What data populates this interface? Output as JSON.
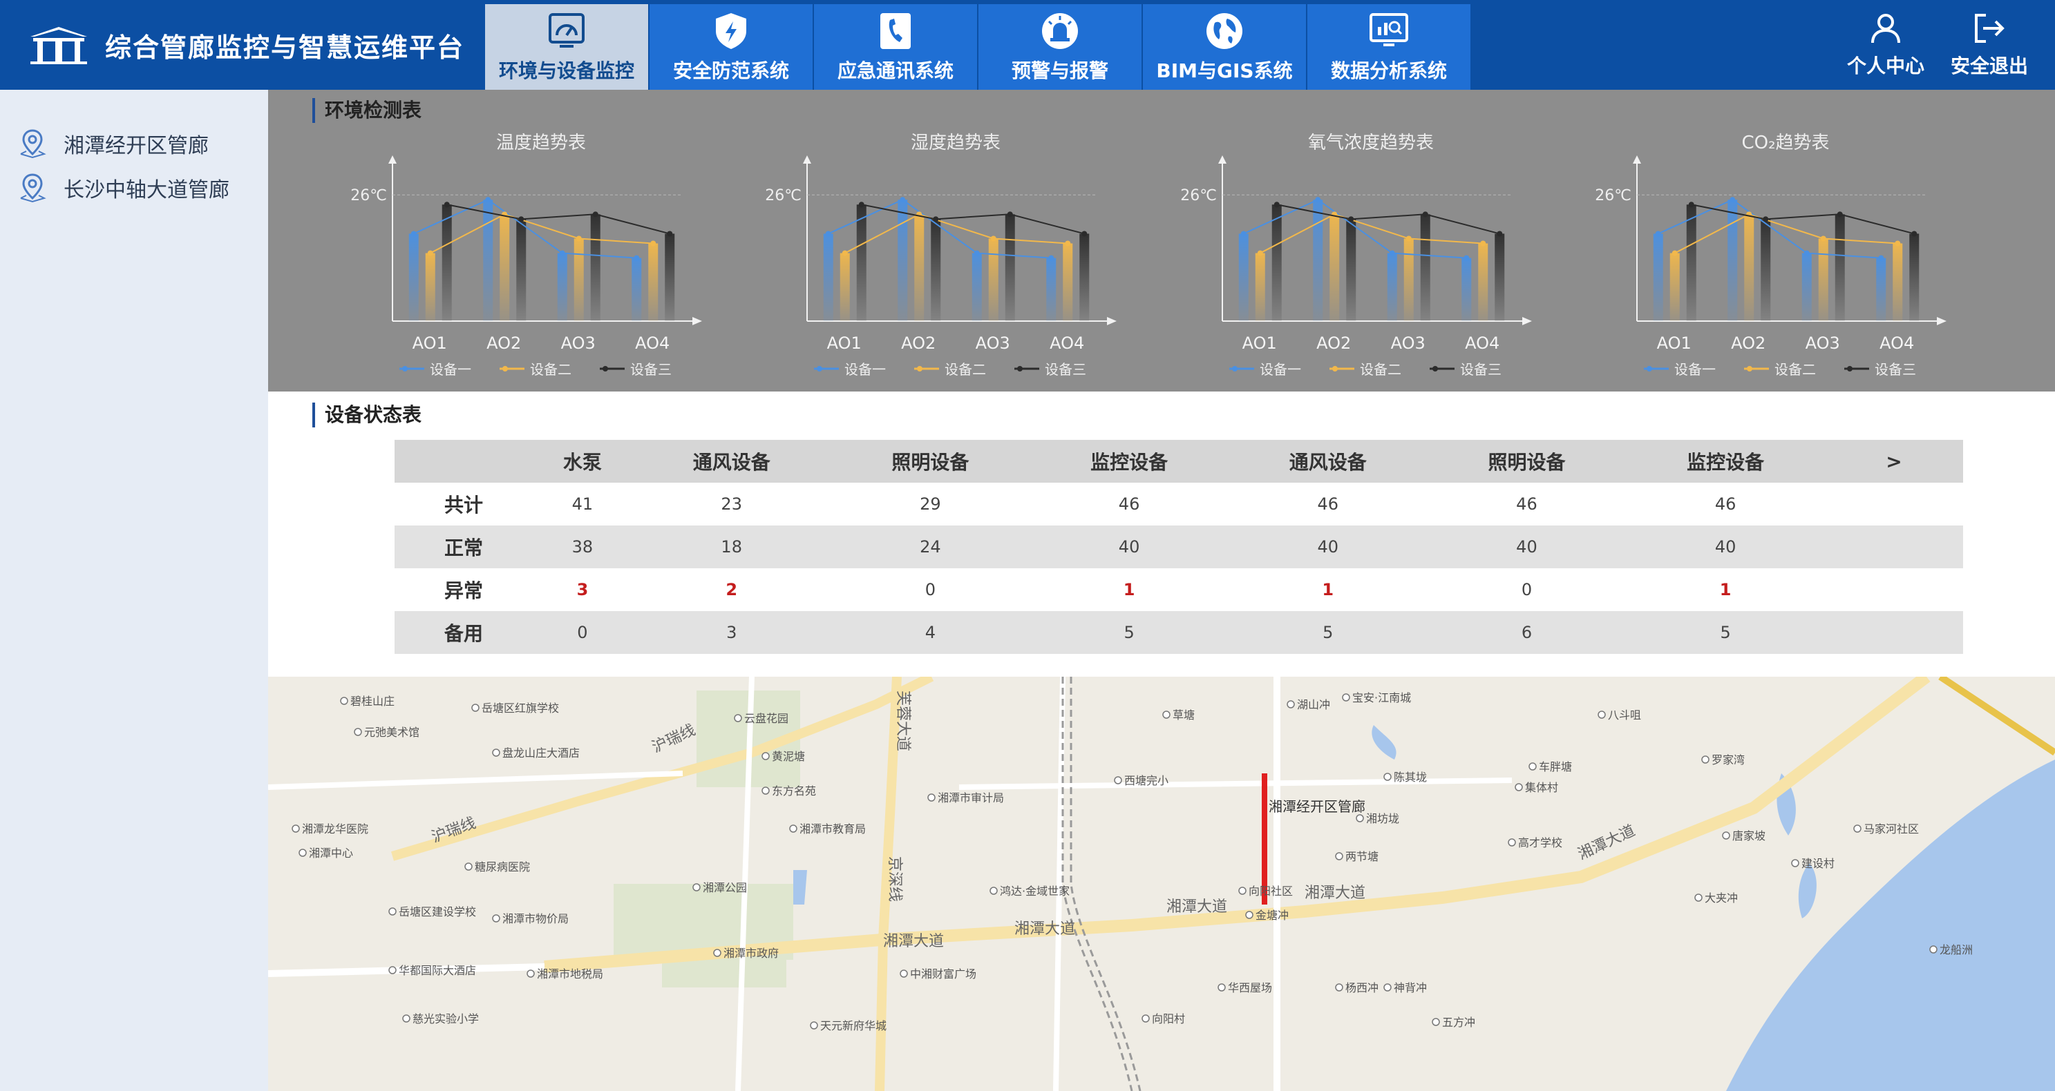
{
  "app": {
    "title": "综合管廊监控与智慧运维平台"
  },
  "nav": [
    {
      "label": "环境与设备监控",
      "icon": "gauge-icon",
      "active": true
    },
    {
      "label": "安全防范系统",
      "icon": "shield-icon",
      "active": false
    },
    {
      "label": "应急通讯系统",
      "icon": "phone-icon",
      "active": false
    },
    {
      "label": "预警与报警",
      "icon": "alarm-light-icon",
      "active": false
    },
    {
      "label": "BIM与GIS系统",
      "icon": "globe-icon",
      "active": false
    },
    {
      "label": "数据分析系统",
      "icon": "analytics-monitor-icon",
      "active": false
    }
  ],
  "user": {
    "center_label": "个人中心",
    "logout_label": "安全退出"
  },
  "sidebar": {
    "items": [
      {
        "label": "湘潭经开区管廊",
        "icon": "location-pin-icon"
      },
      {
        "label": "长沙中轴大道管廊",
        "icon": "location-pin-icon"
      }
    ]
  },
  "env": {
    "section_title": "环境检测表"
  },
  "colors": {
    "series1": "#4a90e2",
    "series2": "#f2b84b",
    "series3": "#2b2b2b",
    "header": "#0c4fa3",
    "nav": "#1f6fd4",
    "abnormal": "#c41d1d"
  },
  "chart_data": [
    {
      "type": "bar",
      "title": "温度趋势表",
      "ref_line_label": "26℃",
      "categories": [
        "AO1",
        "AO2",
        "AO3",
        "AO4"
      ],
      "series": [
        {
          "name": "设备一",
          "values": [
            18,
            25,
            14,
            13
          ],
          "line": [
            18,
            25,
            14,
            13
          ]
        },
        {
          "name": "设备二",
          "values": [
            14,
            22,
            17,
            16
          ],
          "line": [
            14,
            22,
            17,
            16
          ]
        },
        {
          "name": "设备三",
          "values": [
            24,
            21,
            22,
            18
          ],
          "line": [
            24,
            21,
            22,
            18
          ]
        }
      ],
      "ylim": [
        0,
        32
      ]
    },
    {
      "type": "bar",
      "title": "湿度趋势表",
      "ref_line_label": "26℃",
      "categories": [
        "AO1",
        "AO2",
        "AO3",
        "AO4"
      ],
      "series": [
        {
          "name": "设备一",
          "values": [
            18,
            25,
            14,
            13
          ],
          "line": [
            18,
            25,
            14,
            13
          ]
        },
        {
          "name": "设备二",
          "values": [
            14,
            22,
            17,
            16
          ],
          "line": [
            14,
            22,
            17,
            16
          ]
        },
        {
          "name": "设备三",
          "values": [
            24,
            21,
            22,
            18
          ],
          "line": [
            24,
            21,
            22,
            18
          ]
        }
      ],
      "ylim": [
        0,
        32
      ]
    },
    {
      "type": "bar",
      "title": "氧气浓度趋势表",
      "ref_line_label": "26℃",
      "categories": [
        "AO1",
        "AO2",
        "AO3",
        "AO4"
      ],
      "series": [
        {
          "name": "设备一",
          "values": [
            18,
            25,
            14,
            13
          ],
          "line": [
            18,
            25,
            14,
            13
          ]
        },
        {
          "name": "设备二",
          "values": [
            14,
            22,
            17,
            16
          ],
          "line": [
            14,
            22,
            17,
            16
          ]
        },
        {
          "name": "设备三",
          "values": [
            24,
            21,
            22,
            18
          ],
          "line": [
            24,
            21,
            22,
            18
          ]
        }
      ],
      "ylim": [
        0,
        32
      ]
    },
    {
      "type": "bar",
      "title": "CO₂趋势表",
      "ref_line_label": "26℃",
      "categories": [
        "AO1",
        "AO2",
        "AO3",
        "AO4"
      ],
      "series": [
        {
          "name": "设备一",
          "values": [
            18,
            25,
            14,
            13
          ],
          "line": [
            18,
            25,
            14,
            13
          ]
        },
        {
          "name": "设备二",
          "values": [
            14,
            22,
            17,
            16
          ],
          "line": [
            14,
            22,
            17,
            16
          ]
        },
        {
          "name": "设备三",
          "values": [
            24,
            21,
            22,
            18
          ],
          "line": [
            24,
            21,
            22,
            18
          ]
        }
      ],
      "ylim": [
        0,
        32
      ]
    }
  ],
  "status": {
    "section_title": "设备状态表",
    "columns": [
      "水泵",
      "通风设备",
      "照明设备",
      "监控设备",
      "通风设备",
      "照明设备",
      "监控设备"
    ],
    "more_label": ">",
    "rows": [
      {
        "label": "共计",
        "values": [
          "41",
          "23",
          "29",
          "46",
          "46",
          "46",
          "46"
        ]
      },
      {
        "label": "正常",
        "values": [
          "38",
          "18",
          "24",
          "40",
          "40",
          "40",
          "40"
        ]
      },
      {
        "label": "异常",
        "values": [
          "3",
          "2",
          "0",
          "1",
          "1",
          "0",
          "1"
        ]
      },
      {
        "label": "备用",
        "values": [
          "0",
          "3",
          "4",
          "5",
          "5",
          "6",
          "5"
        ]
      }
    ]
  },
  "map": {
    "pipeline_label": "湘潭经开区管廊",
    "roads": [
      "湘潭大道",
      "湘潭大道",
      "湘潭大道",
      "湘潭大道",
      "沪瑞线",
      "沪瑞线",
      "京深线",
      "芙蓉大道",
      "湘潭大道"
    ],
    "pois": [
      "宝安·江南城",
      "西塘完小",
      "湘潭市审计局",
      "东方名苑",
      "湘潭市教育局",
      "湘潭市政府",
      "湘潭龙华医院",
      "湘潭中心",
      "糖尿病医院",
      "湘潭市物价局",
      "湘潭市地税局",
      "中湘财富广场",
      "天元新府华城",
      "鸿达·金域世家",
      "高才学校",
      "华都国际大酒店",
      "盘龙山庄大酒店",
      "元弛美术馆",
      "碧桂山庄",
      "岳塘区红旗学校",
      "云盘花园",
      "黄泥塘",
      "湘潭公园",
      "马家河社区",
      "唐家坡",
      "建设村",
      "大夹冲",
      "罗家湾",
      "八斗咀",
      "车胖塘",
      "集体村",
      "陈其垅",
      "湘坊垅",
      "两节塘",
      "向阳社区",
      "金塘冲",
      "杨西冲",
      "神背冲",
      "华西屋场",
      "五方冲",
      "草塘",
      "湖山冲",
      "向阳村",
      "龙船洲",
      "慈光实验小学",
      "岳塘区建设学校"
    ]
  }
}
